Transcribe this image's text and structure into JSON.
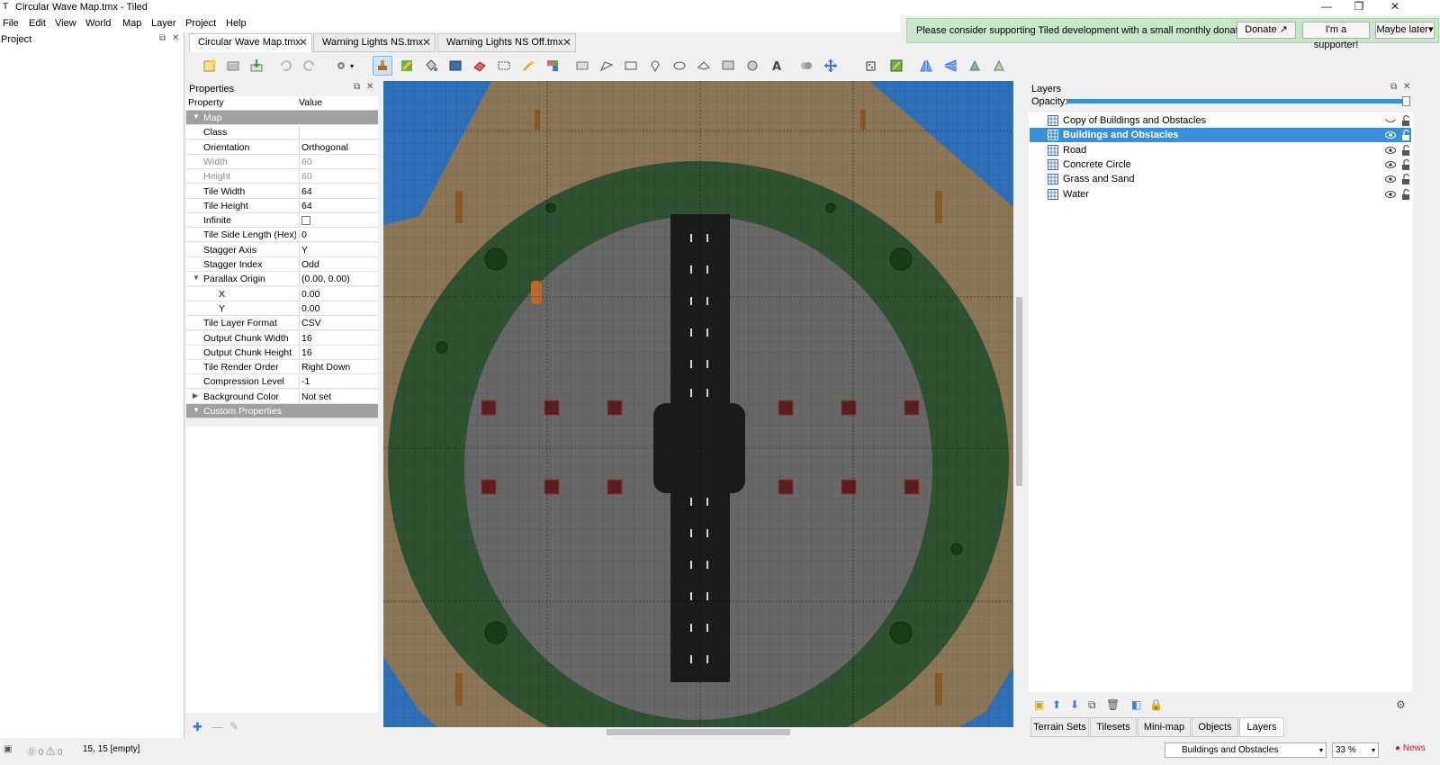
{
  "window": {
    "title": "Circular Wave Map.tmx - Tiled",
    "minimize": "—",
    "restore": "❐",
    "close": "✕"
  },
  "menu": [
    "File",
    "Edit",
    "View",
    "World",
    "Map",
    "Layer",
    "Project",
    "Help"
  ],
  "donation": {
    "message": "Please consider supporting Tiled development with a small monthly donation.",
    "donate": "Donate ↗",
    "supporter": "I'm a supporter!",
    "later": "Maybe later▾"
  },
  "project_panel": {
    "title": "Project"
  },
  "tabs": [
    "Circular Wave Map.tmx",
    "Warning Lights NS.tmx",
    "Warning Lights NS Off.tmx"
  ],
  "properties": {
    "title": "Properties",
    "header": {
      "property": "Property",
      "value": "Value"
    },
    "rows": [
      {
        "k": "Map",
        "v": "",
        "type": "group"
      },
      {
        "k": "Class",
        "v": "",
        "type": "row"
      },
      {
        "k": "Orientation",
        "v": "Orthogonal",
        "type": "row"
      },
      {
        "k": "Width",
        "v": "60",
        "type": "dis"
      },
      {
        "k": "Height",
        "v": "60",
        "type": "dis"
      },
      {
        "k": "Tile Width",
        "v": "64",
        "type": "row"
      },
      {
        "k": "Tile Height",
        "v": "64",
        "type": "row"
      },
      {
        "k": "Infinite",
        "v": "",
        "type": "check"
      },
      {
        "k": "Tile Side Length (Hex)",
        "v": "0",
        "type": "row"
      },
      {
        "k": "Stagger Axis",
        "v": "Y",
        "type": "row"
      },
      {
        "k": "Stagger Index",
        "v": "Odd",
        "type": "row"
      },
      {
        "k": "Parallax Origin",
        "v": "(0.00, 0.00)",
        "type": "expand"
      },
      {
        "k": "X",
        "v": "0.00",
        "type": "sub"
      },
      {
        "k": "Y",
        "v": "0.00",
        "type": "sub"
      },
      {
        "k": "Tile Layer Format",
        "v": "CSV",
        "type": "row"
      },
      {
        "k": "Output Chunk Width",
        "v": "16",
        "type": "row"
      },
      {
        "k": "Output Chunk Height",
        "v": "16",
        "type": "row"
      },
      {
        "k": "Tile Render Order",
        "v": "Right Down",
        "type": "row"
      },
      {
        "k": "Compression Level",
        "v": "-1",
        "type": "row"
      },
      {
        "k": "Background Color",
        "v": "Not set",
        "type": "collapsed"
      },
      {
        "k": "Custom Properties",
        "v": "",
        "type": "group"
      }
    ]
  },
  "layers": {
    "title": "Layers",
    "opacity_label": "Opacity:",
    "opacity": 1.0,
    "items": [
      {
        "name": "Copy of Buildings and Obstacles",
        "visible": false,
        "selected": false
      },
      {
        "name": "Buildings and Obstacles",
        "visible": true,
        "selected": true
      },
      {
        "name": "Road",
        "visible": true,
        "selected": false
      },
      {
        "name": "Concrete Circle",
        "visible": true,
        "selected": false
      },
      {
        "name": "Grass and Sand",
        "visible": true,
        "selected": false
      },
      {
        "name": "Water",
        "visible": true,
        "selected": false
      }
    ]
  },
  "bottom_tabs": [
    "Terrain Sets",
    "Tilesets",
    "Mini-map",
    "Objects",
    "Layers"
  ],
  "status": {
    "coords": "15, 15 [empty]",
    "layer_select": "Buildings and Obstacles",
    "zoom": "33 %",
    "news": "News"
  },
  "colors": {
    "accent": "#3990d6",
    "grass": "#2f5232",
    "sand": "#8a7556",
    "concrete": "#676767",
    "road": "#1b1b1b",
    "water": "#2e6fb7"
  }
}
